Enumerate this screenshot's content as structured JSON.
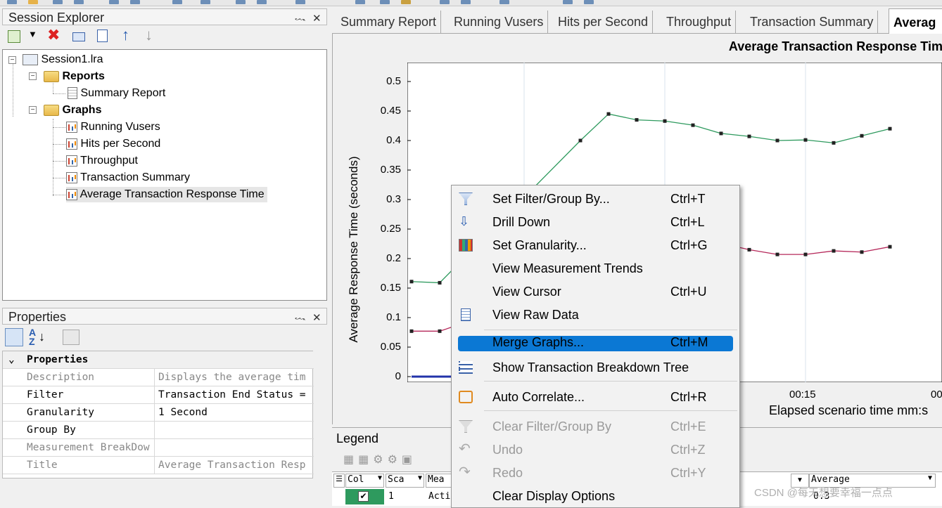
{
  "session_explorer": {
    "title": "Session Explorer",
    "pin_close": "Ǖ ✕",
    "tree": {
      "session": "Session1.lra",
      "reports_folder": "Reports",
      "reports": [
        "Summary Report"
      ],
      "graphs_folder": "Graphs",
      "graphs": [
        "Running Vusers",
        "Hits per Second",
        "Throughput",
        "Transaction Summary",
        "Average Transaction Response Time"
      ]
    }
  },
  "properties": {
    "title": "Properties",
    "section": "Properties",
    "rows": [
      {
        "key": "Description",
        "value": "Displays the average tim"
      },
      {
        "key": "Filter",
        "value": "Transaction End Status ="
      },
      {
        "key": "Granularity",
        "value": "1 Second"
      },
      {
        "key": "Group By",
        "value": ""
      },
      {
        "key": "Measurement BreakDow",
        "value": ""
      },
      {
        "key": "Title",
        "value": "Average Transaction Resp"
      }
    ]
  },
  "tabs": [
    "Summary Report",
    "Running Vusers",
    "Hits per Second",
    "Throughput",
    "Transaction Summary",
    "Averag"
  ],
  "chart_data": {
    "type": "line",
    "title": "Average Transaction Response Tim",
    "ylabel": "Average Response Time (seconds)",
    "xlabel": "Elapsed scenario time mm:s",
    "ylim": [
      0,
      0.5
    ],
    "yticks": [
      "0.5",
      "0.45",
      "0.4",
      "0.35",
      "0.3",
      "0.25",
      "0.2",
      "0.15",
      "0.1",
      "0.05",
      "0"
    ],
    "xticks": [
      "00:15",
      "00"
    ],
    "series": [
      {
        "color": "#2e9a5e",
        "points": [
          [
            -1,
            0.161
          ],
          [
            0,
            0.159
          ],
          [
            5,
            0.4
          ],
          [
            6,
            0.445
          ],
          [
            7,
            0.435
          ],
          [
            8,
            0.433
          ],
          [
            9,
            0.426
          ],
          [
            10,
            0.412
          ],
          [
            11,
            0.407
          ],
          [
            12,
            0.4
          ],
          [
            13,
            0.401
          ],
          [
            14,
            0.396
          ],
          [
            15,
            0.408
          ],
          [
            16,
            0.42
          ]
        ]
      },
      {
        "color": "#b5285a",
        "points": [
          [
            -1,
            0.077
          ],
          [
            0,
            0.077
          ],
          [
            9,
            0.22
          ],
          [
            10,
            0.226
          ],
          [
            11,
            0.215
          ],
          [
            12,
            0.207
          ],
          [
            13,
            0.207
          ],
          [
            14,
            0.213
          ],
          [
            15,
            0.211
          ],
          [
            16,
            0.22
          ]
        ]
      },
      {
        "color": "#2233aa",
        "points": [
          [
            -1,
            0.0
          ],
          [
            1,
            0.0
          ]
        ]
      }
    ]
  },
  "context_menu": [
    {
      "label": "Set Filter/Group By...",
      "shortcut": "Ctrl+T",
      "icon": "filter-icon",
      "enabled": true
    },
    {
      "label": "Drill Down",
      "shortcut": "Ctrl+L",
      "icon": "drill-down-icon",
      "enabled": true
    },
    {
      "label": "Set Granularity...",
      "shortcut": "Ctrl+G",
      "icon": "granularity-icon",
      "enabled": true
    },
    {
      "label": "View Measurement Trends",
      "shortcut": "",
      "icon": "",
      "enabled": true
    },
    {
      "label": "View Cursor",
      "shortcut": "Ctrl+U",
      "icon": "",
      "enabled": true
    },
    {
      "label": "View Raw Data",
      "shortcut": "",
      "icon": "raw-data-icon",
      "enabled": true
    },
    {
      "label": "Merge Graphs...",
      "shortcut": "Ctrl+M",
      "icon": "",
      "enabled": true,
      "highlighted": true
    },
    {
      "label": "Show Transaction Breakdown Tree",
      "shortcut": "",
      "icon": "breakdown-tree-icon",
      "enabled": true
    },
    {
      "label": "Auto Correlate...",
      "shortcut": "Ctrl+R",
      "icon": "auto-correlate-icon",
      "enabled": true
    },
    {
      "label": "Clear Filter/Group By",
      "shortcut": "Ctrl+E",
      "icon": "clear-filter-icon",
      "enabled": false
    },
    {
      "label": "Undo",
      "shortcut": "Ctrl+Z",
      "icon": "undo-icon",
      "enabled": false
    },
    {
      "label": "Redo",
      "shortcut": "Ctrl+Y",
      "icon": "redo-icon",
      "enabled": false
    },
    {
      "label": "Clear Display Options",
      "shortcut": "",
      "icon": "",
      "enabled": true
    }
  ],
  "legend": {
    "title": "Legend",
    "headers": [
      "Col",
      "Sca",
      "Mea",
      "Average"
    ],
    "row": {
      "scale": "1",
      "measurement": "Acti",
      "average": "0.3"
    }
  },
  "watermark": "CSDN @每天想要幸福一点点"
}
